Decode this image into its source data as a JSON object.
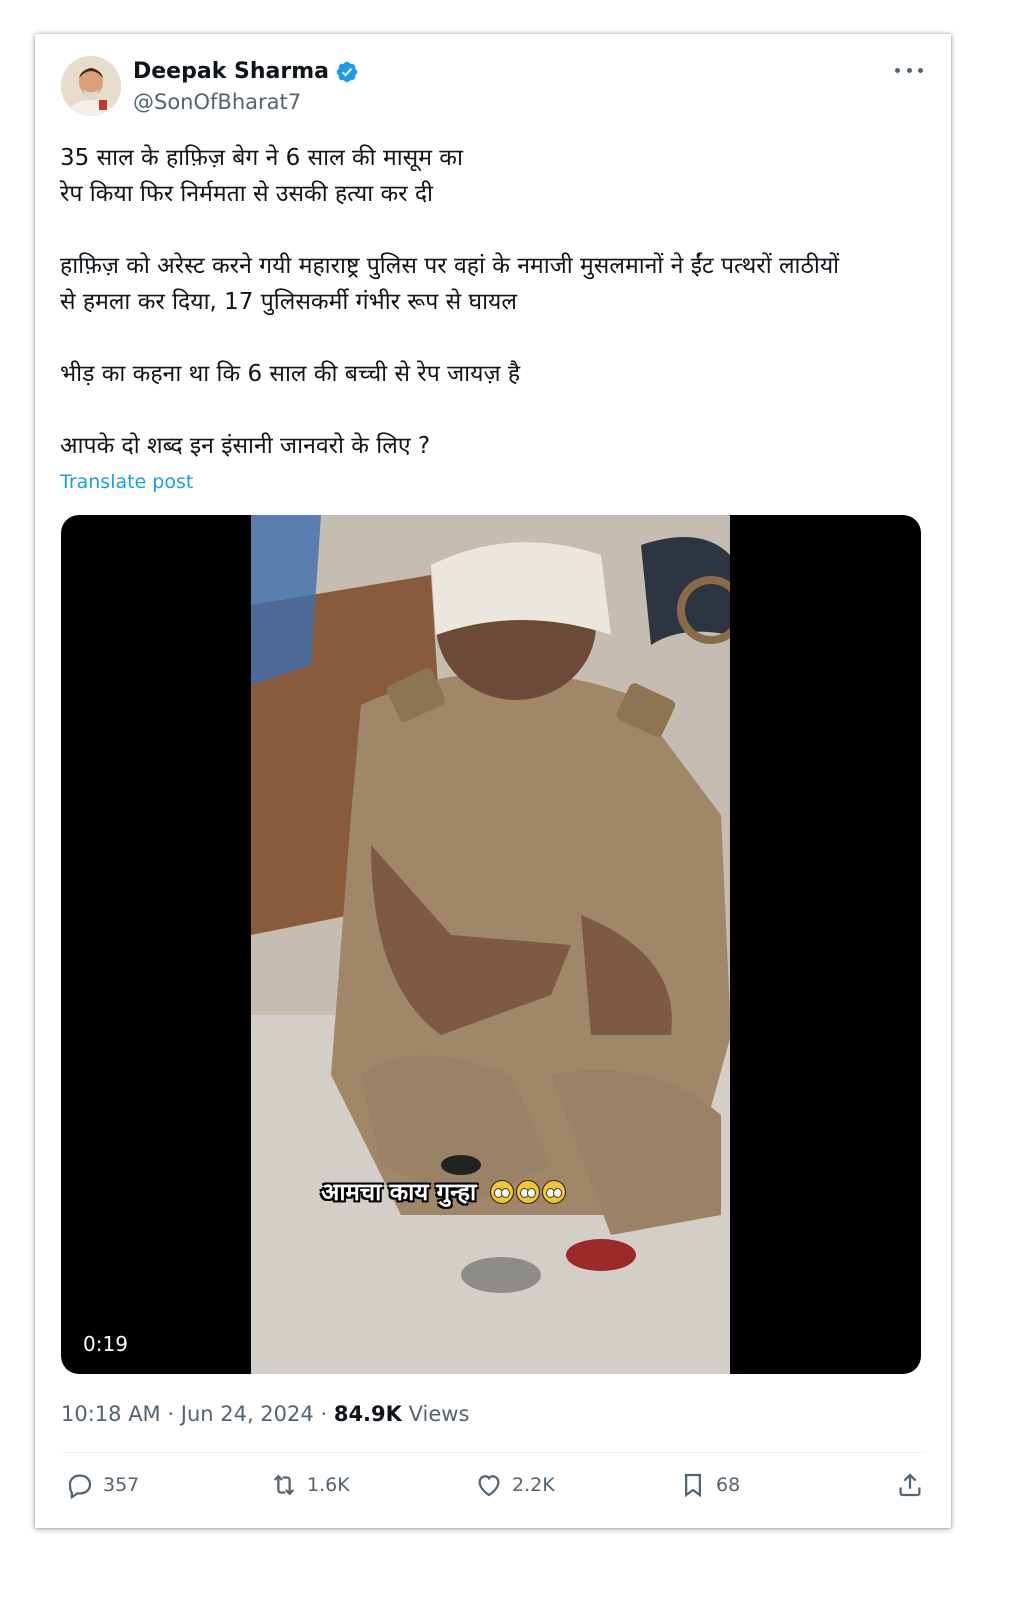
{
  "author": {
    "name": "Deepak Sharma",
    "handle": "@SonOfBharat7",
    "verified": true
  },
  "tweet": {
    "paragraphs": [
      "35 साल के हाफ़िज़ बेग ने 6 साल की मासूम का\nरेप किया फिर निर्ममता से उसकी हत्या कर दी",
      "हाफ़िज़ को अरेस्ट करने गयी महाराष्ट्र पुलिस पर वहां के नमाजी मुसलमानों ने ईंट पत्थरों लाठीयों\nसे हमला कर दिया, 17 पुलिसकर्मी गंभीर रूप से घायल",
      "भीड़ का कहना था कि 6 साल की बच्ची से रेप जायज़ है",
      "आपके दो शब्द इन इंसानी जानवरो के लिए ?"
    ],
    "translate_label": "Translate post"
  },
  "media": {
    "caption": "आमचा काय गुन्हा",
    "duration": "0:19"
  },
  "meta": {
    "time": "10:18 AM",
    "separator": "·",
    "date": "Jun 24, 2024",
    "views_count": "84.9K",
    "views_label": "Views"
  },
  "actions": {
    "replies": "357",
    "reposts": "1.6K",
    "likes": "2.2K",
    "bookmarks": "68"
  },
  "colors": {
    "accent": "#1d9bf0",
    "secondary_text": "#536471",
    "primary_text": "#0f1419"
  }
}
